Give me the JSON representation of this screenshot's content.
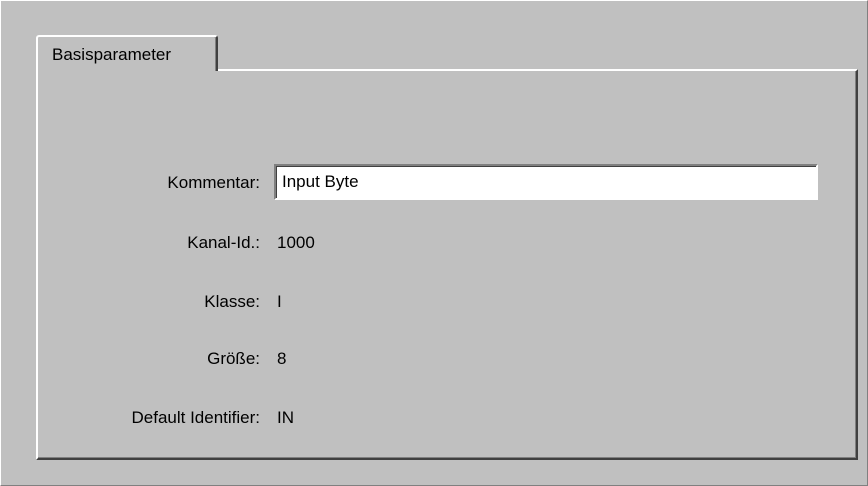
{
  "tabs": [
    {
      "label": "Basisparameter",
      "active": true
    }
  ],
  "fields": {
    "kommentar": {
      "label": "Kommentar:",
      "value": "Input Byte"
    },
    "kanal_id": {
      "label": "Kanal-Id.:",
      "value": "1000"
    },
    "klasse": {
      "label": "Klasse:",
      "value": "I"
    },
    "groesse": {
      "label": "Größe:",
      "value": "8"
    },
    "default_identifier": {
      "label": "Default Identifier:",
      "value": "IN"
    }
  },
  "colors": {
    "face": "#c0c0c0",
    "highlight": "#ffffff",
    "shadow": "#808080",
    "dark_shadow": "#404040",
    "field_background": "#ffffff"
  }
}
